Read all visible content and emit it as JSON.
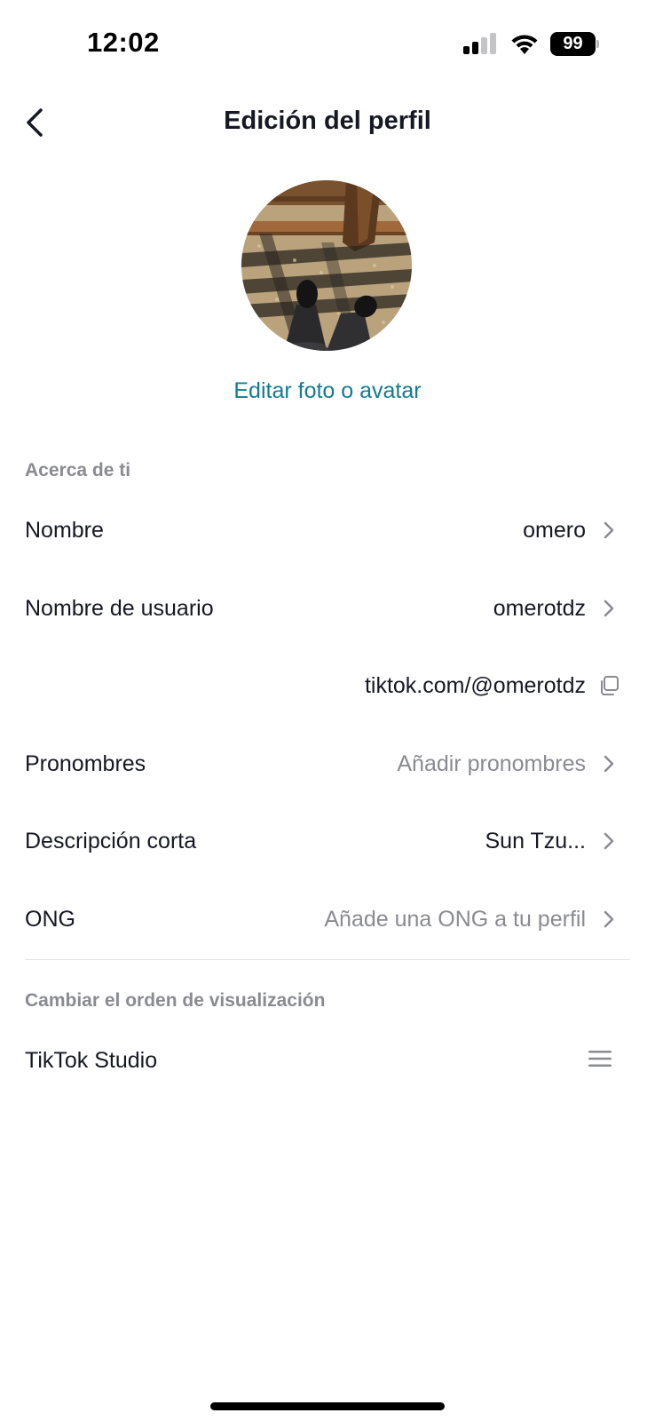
{
  "status_bar": {
    "time": "12:02",
    "battery": "99",
    "signal_icon": "cellular-signal-icon",
    "wifi_icon": "wifi-icon"
  },
  "header": {
    "title": "Edición del perfil",
    "back_icon": "chevron-left-icon"
  },
  "avatar": {
    "edit_label": "Editar foto o avatar"
  },
  "about_section": {
    "label": "Acerca de ti",
    "rows": [
      {
        "label": "Nombre",
        "value": "omero"
      },
      {
        "label": "Nombre de usuario",
        "value": "omerotdz"
      },
      {
        "label": "",
        "value": "tiktok.com/@omerotdz"
      },
      {
        "label": "Pronombres",
        "value": "Añadir pronombres"
      },
      {
        "label": "Descripción corta",
        "value": "Sun Tzu..."
      },
      {
        "label": "ONG",
        "value": "Añade una ONG a tu perfil"
      }
    ]
  },
  "order_section": {
    "label": "Cambiar el orden de visualización",
    "rows": [
      {
        "label": "TikTok Studio"
      }
    ]
  },
  "colors": {
    "accent": "#117c8f",
    "text_primary": "#161823",
    "text_secondary": "#8a8b91",
    "divider": "#e3e3e4"
  }
}
